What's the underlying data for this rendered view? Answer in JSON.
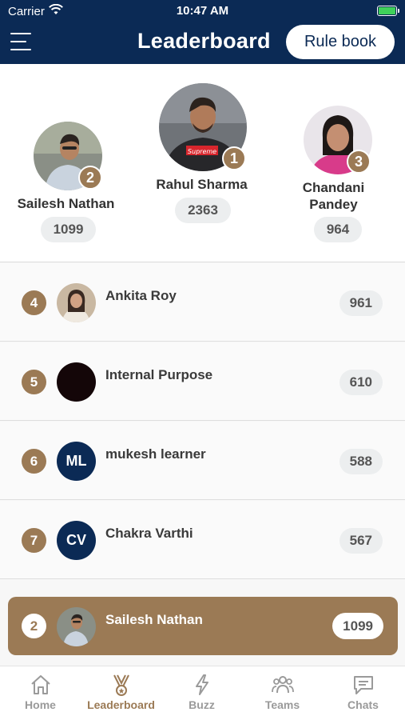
{
  "status_bar": {
    "carrier": "Carrier",
    "time": "10:47 AM"
  },
  "header": {
    "title": "Leaderboard",
    "rule_book_label": "Rule book"
  },
  "podium": {
    "first": {
      "rank": "1",
      "name": "Rahul Sharma",
      "score": "2363",
      "shirt_text": "Supreme"
    },
    "second": {
      "rank": "2",
      "name": "Sailesh Nathan",
      "score": "1099"
    },
    "third": {
      "rank": "3",
      "name": "Chandani Pandey",
      "score": "964"
    }
  },
  "rows": [
    {
      "rank": "4",
      "name": "Ankita Roy",
      "score": "961",
      "avatar": "photo"
    },
    {
      "rank": "5",
      "name": "Internal Purpose",
      "score": "610",
      "avatar": "black"
    },
    {
      "rank": "6",
      "name": "mukesh learner",
      "score": "588",
      "avatar": "initials",
      "initials": "ML"
    },
    {
      "rank": "7",
      "name": "Chakra Varthi",
      "score": "567",
      "avatar": "initials",
      "initials": "CV"
    }
  ],
  "current_user": {
    "rank": "2",
    "name": "Sailesh Nathan",
    "score": "1099"
  },
  "tabs": [
    {
      "label": "Home",
      "icon": "home-icon",
      "active": false
    },
    {
      "label": "Leaderboard",
      "icon": "medal-icon",
      "active": true
    },
    {
      "label": "Buzz",
      "icon": "lightning-icon",
      "active": false
    },
    {
      "label": "Teams",
      "icon": "teams-icon",
      "active": false
    },
    {
      "label": "Chats",
      "icon": "chat-icon",
      "active": false
    }
  ],
  "colors": {
    "header_bg": "#0b2a55",
    "accent": "#9b7a55",
    "initials_bg": "#0b2a55"
  }
}
